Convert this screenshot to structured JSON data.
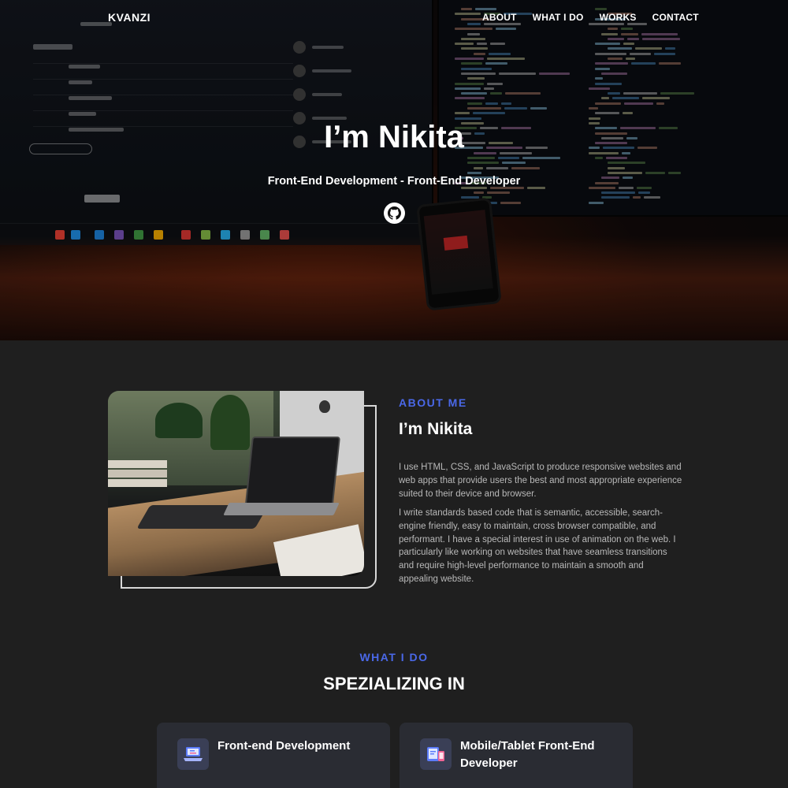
{
  "header": {
    "brand": "KVANZI",
    "nav": [
      {
        "label": "ABOUT"
      },
      {
        "label": "WHAT I DO"
      },
      {
        "label": "WORKS"
      },
      {
        "label": "CONTACT"
      }
    ]
  },
  "hero": {
    "title": "I’m Nikita",
    "subtitle": "Front-End Development - Front-End Developer",
    "github_icon": "github-icon"
  },
  "about": {
    "label": "ABOUT ME",
    "title": "I’m Nikita",
    "paragraph1": "I use HTML, CSS, and JavaScript to produce responsive websites and web apps that provide users the best and most appropriate experience suited to their device and browser.",
    "paragraph2": "I write standards based code that is semantic, accessible, search-engine friendly, easy to maintain, cross browser compatible, and performant. I have a special interest in use of animation on the web. I particularly like working on websites that have seamless transitions and require high-level performance to maintain a smooth and appealing website."
  },
  "what_i_do": {
    "label": "WHAT I DO",
    "title": "SPEZIALIZING IN",
    "cards": [
      {
        "title": "Front-end Development",
        "icon": "laptop-code-icon"
      },
      {
        "title": "Mobile/Tablet Front-End Developer",
        "icon": "mobile-tablet-icon"
      }
    ]
  },
  "colors": {
    "accent": "#4a68e8",
    "background": "#1f1f1f",
    "card": "#2a2c33"
  }
}
